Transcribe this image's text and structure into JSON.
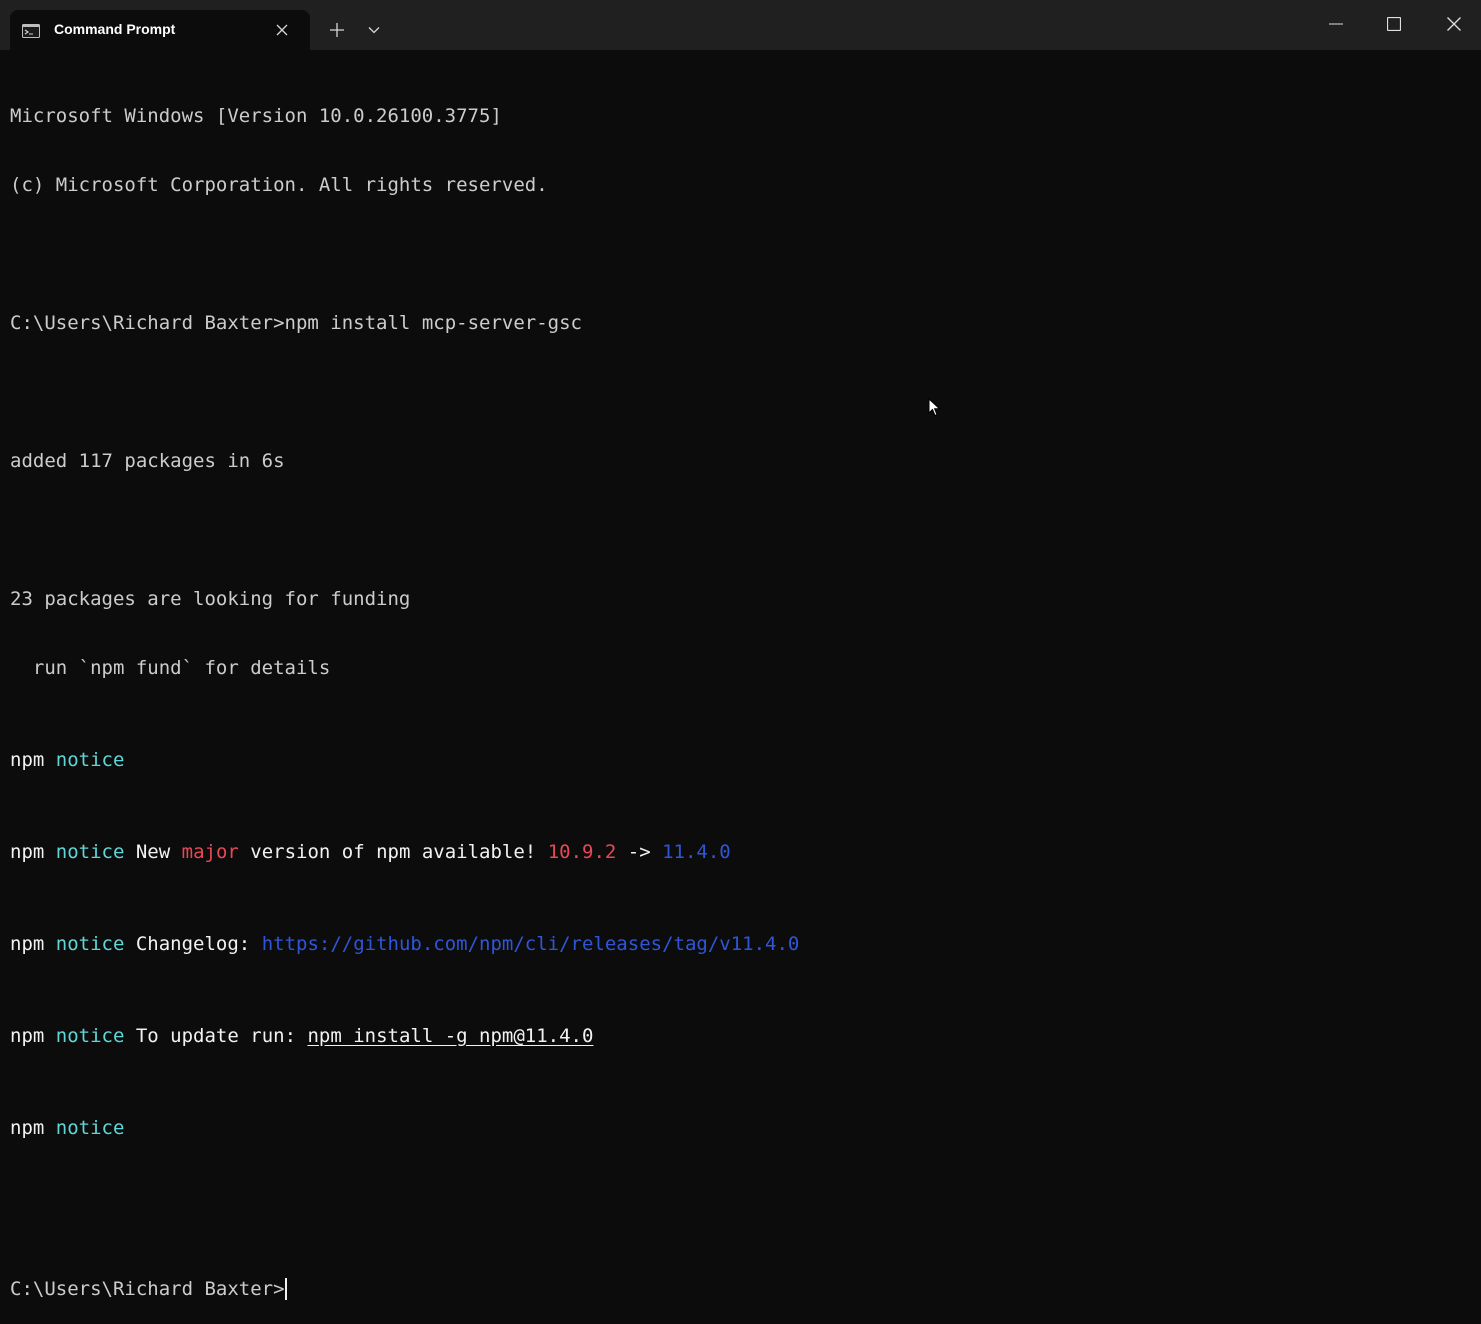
{
  "window": {
    "tab_title": "Command Prompt",
    "tab_icon": "terminal-icon",
    "close_tab_icon": "close-icon",
    "new_tab_icon": "plus-icon",
    "dropdown_icon": "chevron-down-icon",
    "minimize_icon": "minimize-icon",
    "maximize_icon": "maximize-icon",
    "close_window_icon": "close-icon"
  },
  "terminal": {
    "line1": "Microsoft Windows [Version 10.0.26100.3775]",
    "line2": "(c) Microsoft Corporation. All rights reserved.",
    "prompt1": "C:\\Users\\Richard Baxter>",
    "command1": "npm install mcp-server-gsc",
    "added": "added 117 packages in 6s",
    "funding1": "23 packages are looking for funding",
    "funding2": "  run `npm fund` for details",
    "npm": "npm",
    "notice": "notice",
    "new_text": " New ",
    "major": "major",
    "version_text": " version of npm available! ",
    "old_version": "10.9.2",
    "arrow": " -> ",
    "new_version": "11.4.0",
    "changelog_label": " Changelog: ",
    "changelog_url": "https://github.com/npm/cli/releases/tag/v11.4.0",
    "update_label": " To update run: ",
    "update_cmd": "npm install -g npm@11.4.0",
    "prompt2": "C:\\Users\\Richard Baxter>"
  },
  "colors": {
    "background": "#0c0c0c",
    "titlebar": "#202020",
    "text": "#cccccc",
    "notice": "#61d6d6",
    "major": "#e74856",
    "version_old": "#c50f1f",
    "version_new": "#3b78ff"
  }
}
